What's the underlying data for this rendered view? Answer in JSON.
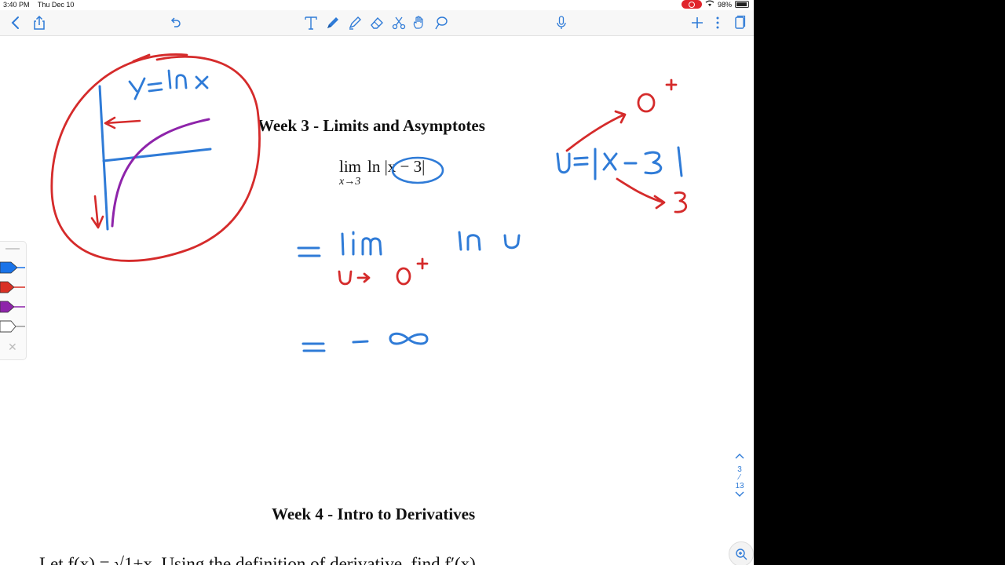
{
  "status_bar": {
    "time": "3:40 PM",
    "date": "Thu Dec 10",
    "battery": "98%"
  },
  "toolbar": {
    "icons": [
      "back-icon",
      "share-icon",
      "undo-icon",
      "text-tool-icon",
      "pen-tool-icon",
      "highlighter-tool-icon",
      "eraser-tool-icon",
      "scissors-tool-icon",
      "hand-tool-icon",
      "lasso-tool-icon",
      "microphone-icon",
      "add-icon",
      "more-icon",
      "pages-icon"
    ],
    "accent": "#2f7bd7"
  },
  "document": {
    "week3_title": "Week 3 - Limits and Asymptotes",
    "limit_expr": {
      "op": "lim",
      "sub": "x→3",
      "body": "ln |x − 3|"
    },
    "week4_title": "Week 4 - Intro to Derivatives",
    "cut_line": "Let f(x) = √1+x. Using the definition of derivative, find f′(x)"
  },
  "handwriting": {
    "graph_label": "y = ln x",
    "substitution": "u = |x − 3|",
    "zero_plus": "0⁺",
    "three": "3",
    "step1_lim": "= lim",
    "step1_sub": "u → 0⁺",
    "step1_ln": "ln u",
    "step2": "= − ∞"
  },
  "pen_palette": {
    "colors": [
      "#1a73e8",
      "#d93025",
      "#8e24aa",
      "#ffffff"
    ]
  },
  "page_nav": {
    "current": "3",
    "total": "13"
  }
}
